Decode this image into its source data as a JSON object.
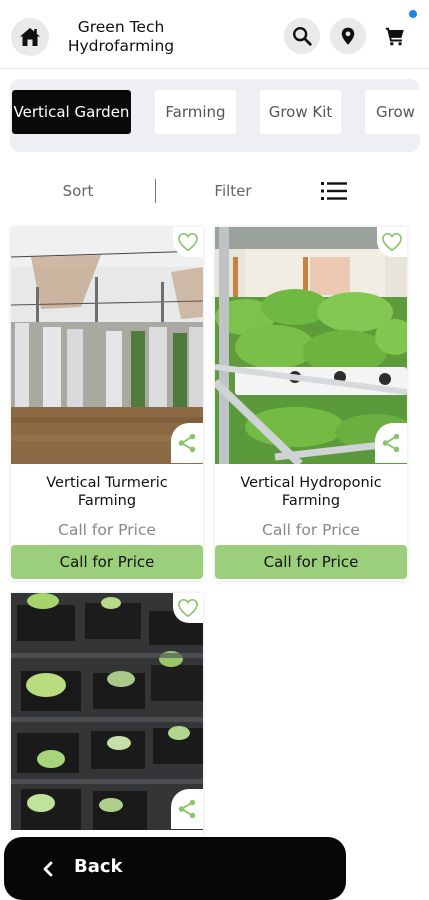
{
  "header": {
    "brand_line1": "Green Tech",
    "brand_line2": "Hydrofarming",
    "icons": [
      "home-icon",
      "search-icon",
      "location-pin-icon",
      "cart-icon"
    ],
    "cart_dot_color": "#1e88e5"
  },
  "categories": [
    {
      "label": "Vertical Garden",
      "active": true
    },
    {
      "label": "Farming",
      "active": false
    },
    {
      "label": "Grow Kit",
      "active": false
    },
    {
      "label": "Grow",
      "active": false
    }
  ],
  "toolbar": {
    "sort_label": "Sort",
    "filter_label": "Filter",
    "view_icon": "list-view-icon"
  },
  "products": [
    {
      "title": "Vertical Turmeric Farming",
      "price": "Call for Price",
      "cta": "Call for Price"
    },
    {
      "title": "Vertical Hydroponic Farming",
      "price": "Call for Price",
      "cta": "Call for Price"
    },
    {
      "title": "",
      "price": "",
      "cta": ""
    }
  ],
  "colors": {
    "accent_green": "#9ccf7c",
    "icon_green": "#8bc46a",
    "active_chip": "#0a0a0a"
  },
  "footer": {
    "back_label": "Back"
  }
}
